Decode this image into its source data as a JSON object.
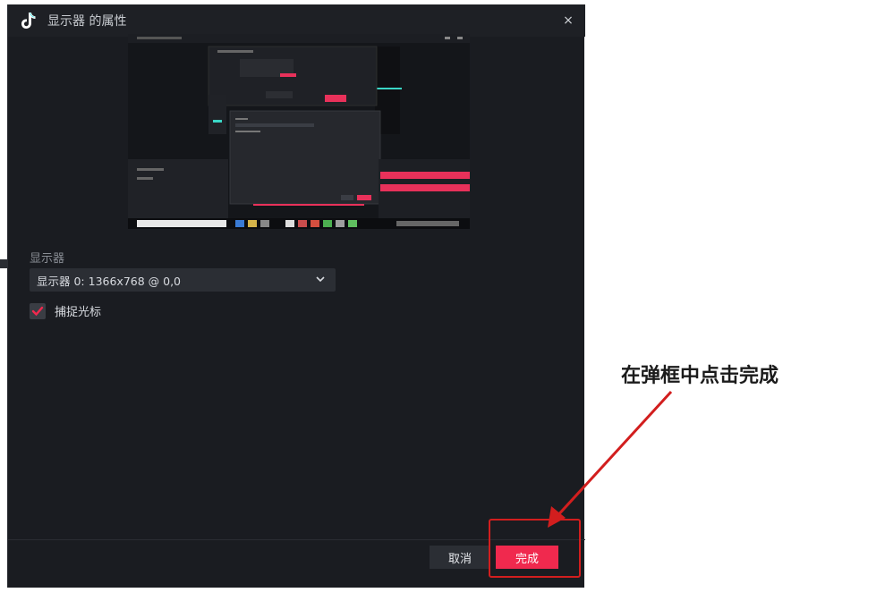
{
  "window": {
    "title": "显示器 的属性",
    "close_glyph": "×"
  },
  "preview": {
    "description_icon": "screen-preview"
  },
  "display": {
    "label": "显示器",
    "selected": "显示器 0: 1366x768 @ 0,0"
  },
  "capture_cursor": {
    "label": "捕捉光标",
    "checked": true
  },
  "footer": {
    "cancel_label": "取消",
    "done_label": "完成"
  },
  "annotation": {
    "text": "在弹框中点击完成"
  },
  "colors": {
    "accent": "#f0294e",
    "dialog_bg": "#1a1c21",
    "annotation_red": "#d21e1e"
  }
}
